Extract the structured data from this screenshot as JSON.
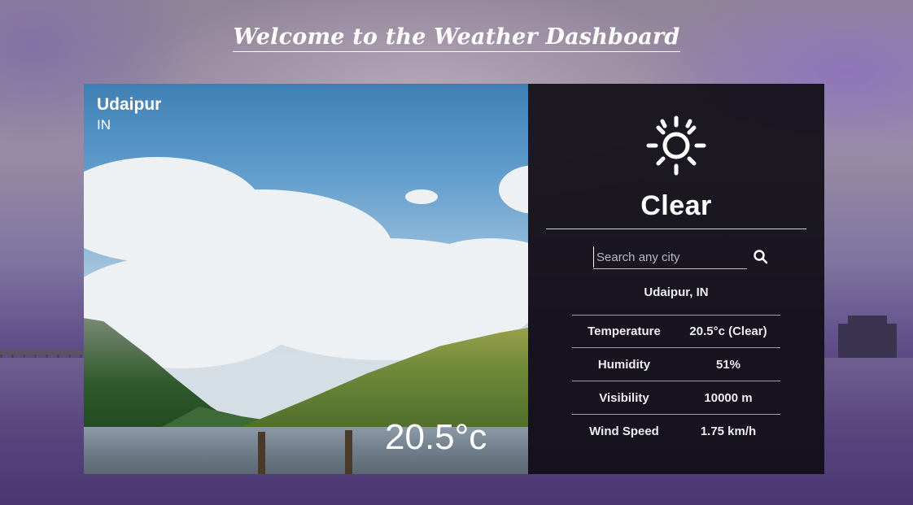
{
  "header": {
    "title": "Welcome to the Weather Dashboard"
  },
  "location_card": {
    "city": "Udaipur",
    "country": "IN",
    "temperature": "20.5°c"
  },
  "weather_panel": {
    "icon": "sun-icon",
    "condition": "Clear",
    "search": {
      "placeholder": "Search any city",
      "value": ""
    },
    "search_button_icon": "search-icon",
    "location_label": "Udaipur, IN",
    "details": [
      {
        "label": "Temperature",
        "value": "20.5°c (Clear)"
      },
      {
        "label": "Humidity",
        "value": "51%"
      },
      {
        "label": "Visibility",
        "value": "10000 m"
      },
      {
        "label": "Wind Speed",
        "value": "1.75 km/h"
      }
    ]
  },
  "colors": {
    "panel_bg": "#100e16",
    "text": "#ffffff",
    "background_purple": "#5c4a86"
  }
}
